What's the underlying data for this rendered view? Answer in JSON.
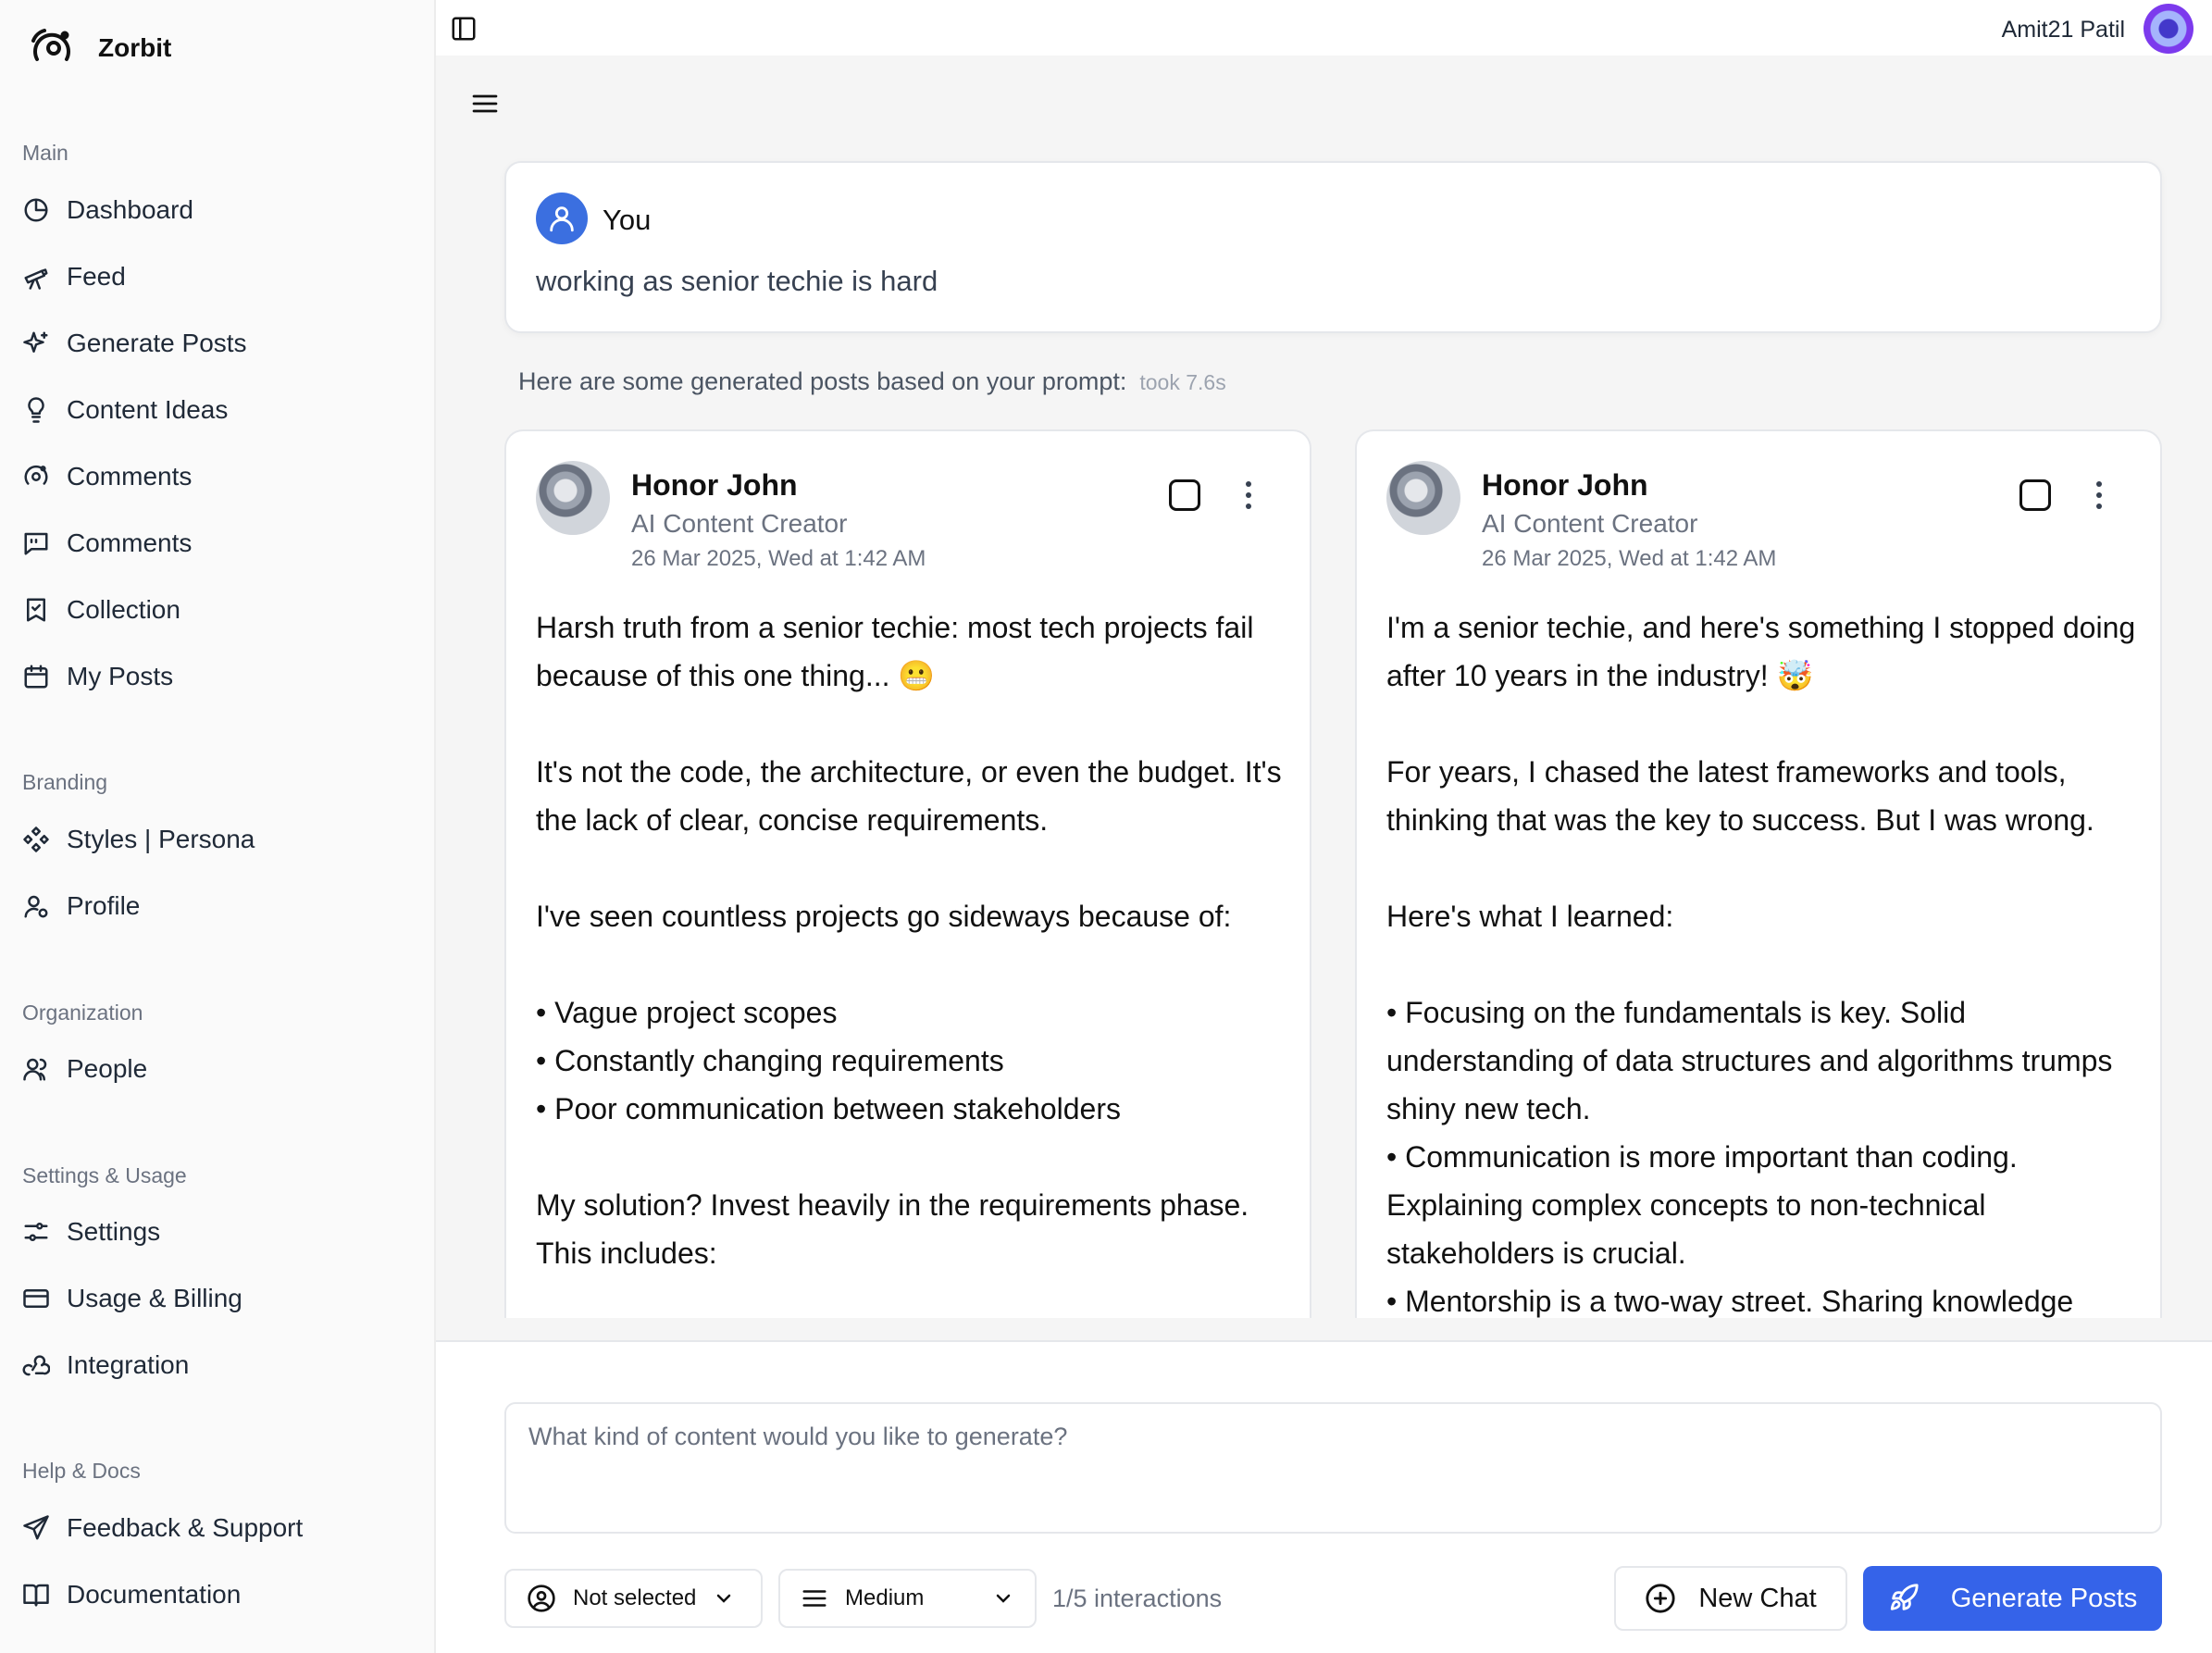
{
  "brand": {
    "name": "Zorbit"
  },
  "sidebar": {
    "sections": [
      {
        "label": "Main"
      },
      {
        "label": "Branding"
      },
      {
        "label": "Organization"
      },
      {
        "label": "Settings & Usage"
      },
      {
        "label": "Help & Docs"
      }
    ],
    "items": [
      {
        "label": "Dashboard",
        "icon": "pie-chart-icon"
      },
      {
        "label": "Feed",
        "icon": "telescope-icon"
      },
      {
        "label": "Generate Posts",
        "icon": "sparkles-icon"
      },
      {
        "label": "Content Ideas",
        "icon": "lightbulb-icon"
      },
      {
        "label": "Comments",
        "icon": "orbit-icon"
      },
      {
        "label": "Comments",
        "icon": "message-square-icon"
      },
      {
        "label": "Collection",
        "icon": "bookmark-check-icon"
      },
      {
        "label": "My Posts",
        "icon": "calendar-icon"
      },
      {
        "label": "Styles | Persona",
        "icon": "component-icon"
      },
      {
        "label": "Profile",
        "icon": "user-cog-icon"
      },
      {
        "label": "People",
        "icon": "users-icon"
      },
      {
        "label": "Settings",
        "icon": "sliders-icon"
      },
      {
        "label": "Usage & Billing",
        "icon": "credit-card-icon"
      },
      {
        "label": "Integration",
        "icon": "webhook-icon"
      },
      {
        "label": "Feedback & Support",
        "icon": "send-icon"
      },
      {
        "label": "Documentation",
        "icon": "book-open-icon"
      }
    ]
  },
  "header": {
    "user_name": "Amit21 Patil"
  },
  "prompt": {
    "author": "You",
    "text": "working as senior techie is hard"
  },
  "results": {
    "intro": "Here are some generated posts based on your prompt:",
    "took": "took 7.6s"
  },
  "posts": [
    {
      "author": "Honor John",
      "role": "AI Content Creator",
      "date": "26 Mar 2025, Wed at 1:42 AM",
      "body": "Harsh truth from a senior techie: most tech projects fail because of this one thing... 😬\n\nIt's not the code, the architecture, or even the budget. It's the lack of clear, concise requirements.\n\nI've seen countless projects go sideways because of:\n\n• Vague project scopes\n• Constantly changing requirements\n• Poor communication between stakeholders\n\nMy solution? Invest heavily in the requirements phase. This includes:"
    },
    {
      "author": "Honor John",
      "role": "AI Content Creator",
      "date": "26 Mar 2025, Wed at 1:42 AM",
      "body": "I'm a senior techie, and here's something I stopped doing after 10 years in the industry! 🤯\n\nFor years, I chased the latest frameworks and tools, thinking that was the key to success. But I was wrong.\n\nHere's what I learned:\n\n• Focusing on the fundamentals is key. Solid understanding of data structures and algorithms trumps shiny new tech.\n• Communication is more important than coding. Explaining complex concepts to non-technical stakeholders is crucial.\n• Mentorship is a two-way street. Sharing knowledge"
    }
  ],
  "composer": {
    "placeholder": "What kind of content would you like to generate?",
    "persona_select": "Not selected",
    "length_select": "Medium",
    "interactions": "1/5 interactions",
    "new_chat_label": "New Chat",
    "generate_label": "Generate Posts"
  },
  "colors": {
    "accent": "#3563e9",
    "sidebar_bg": "#fafafa",
    "main_bg": "#f5f5f5"
  }
}
